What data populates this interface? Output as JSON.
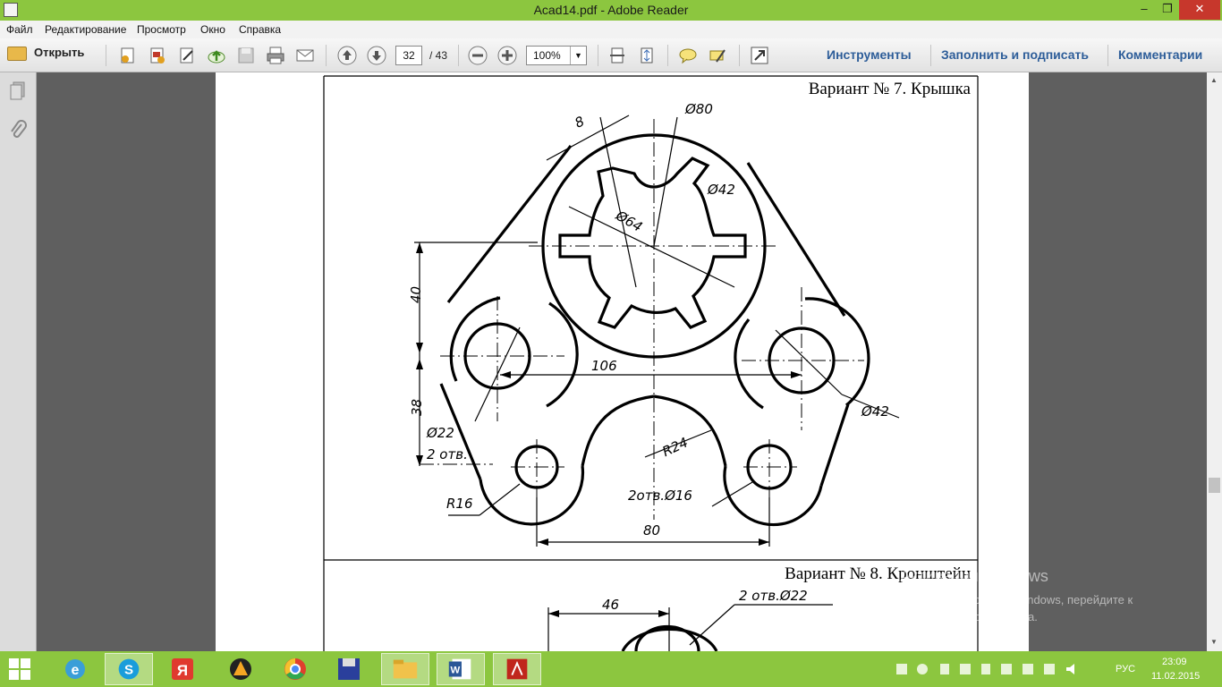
{
  "window": {
    "title": "Acad14.pdf - Adobe Reader",
    "min_glyph": "–",
    "max_glyph": "❐",
    "close_glyph": "✕"
  },
  "menu": [
    "Файл",
    "Редактирование",
    "Просмотр",
    "Окно",
    "Справка"
  ],
  "toolbar": {
    "open_label": "Открыть",
    "page_current": "32",
    "page_total": "/ 43",
    "zoom": "100%",
    "tools_label": "Инструменты",
    "fill_sign_label": "Заполнить и подписать",
    "comments_label": "Комментарии"
  },
  "document": {
    "variant7_title": "Вариант № 7. Крышка",
    "variant8_title": "Вариант № 8. Кронштейн",
    "dims7": {
      "d_80": "Ø80",
      "d_42_top": "Ø42",
      "d_64": "Ø64",
      "w_8": "8",
      "h_40": "40",
      "h_38": "38",
      "w_106": "106",
      "d_22": "Ø22",
      "holes_2": "2 отв.",
      "r_24": "R24",
      "d_42_right": "Ø42",
      "r_16": "R16",
      "holes_16": "2отв.Ø16",
      "w_80": "80"
    },
    "dims8": {
      "w_46": "46",
      "holes_22": "2 отв.Ø22"
    }
  },
  "activation": {
    "line1": "Активация Windows",
    "line2": "Чтобы активировать Windows, перейдите к",
    "line3": "параметрам компьютера."
  },
  "taskbar": {
    "apps": [
      "start-button",
      "internet-explorer",
      "skype",
      "yandex-browser",
      "aimp",
      "chrome",
      "save-app",
      "file-explorer",
      "word",
      "adobe-reader"
    ],
    "lang": "РУС",
    "time": "23:09",
    "date": "11.02.2015"
  },
  "colors": {
    "titlebar": "#8cc63f",
    "taskbar": "#8cc63f",
    "accent_link": "#2d5d99",
    "close": "#c7372c"
  }
}
